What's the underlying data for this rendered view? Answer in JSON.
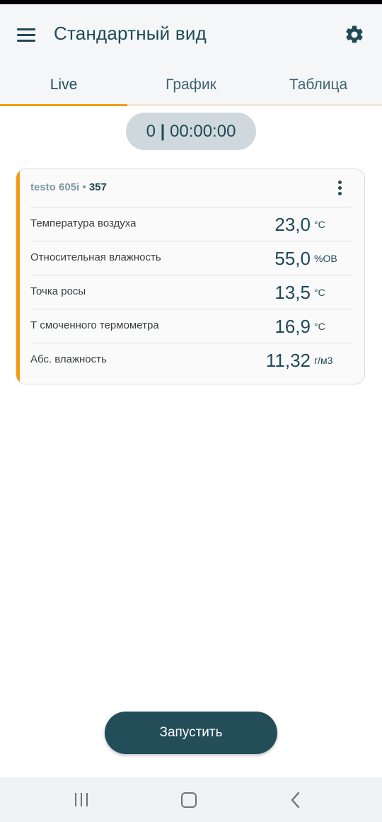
{
  "header": {
    "title": "Стандартный вид",
    "menu_icon": "hamburger-menu-icon",
    "settings_icon": "gear-icon"
  },
  "tabs": [
    {
      "label": "Live",
      "active": true
    },
    {
      "label": "График",
      "active": false
    },
    {
      "label": "Таблица",
      "active": false
    }
  ],
  "timer": {
    "count": "0",
    "separator": "|",
    "elapsed": "00:00:00"
  },
  "device_card": {
    "name": "testo 605i",
    "separator": "•",
    "serial": "357",
    "menu_icon": "more-vertical-icon",
    "readings": [
      {
        "label": "Температура воздуха",
        "value": "23,0",
        "unit": "°C"
      },
      {
        "label": "Относительная влажность",
        "value": "55,0",
        "unit": "%ОВ"
      },
      {
        "label": "Точка росы",
        "value": "13,5",
        "unit": "°C"
      },
      {
        "label": "Т смоченного термометра",
        "value": "16,9",
        "unit": "°C"
      },
      {
        "label": "Абс. влажность",
        "value": "11,32",
        "unit": "г/м3"
      }
    ]
  },
  "start_button": {
    "label": "Запустить"
  },
  "nav": {
    "recent_icon": "recent-apps-icon",
    "home_icon": "home-icon",
    "back_icon": "back-icon"
  },
  "colors": {
    "accent": "#f39c12",
    "primary": "#244d5a",
    "header_bg": "#f5f6f8",
    "pill_bg": "#cfd8dd"
  }
}
